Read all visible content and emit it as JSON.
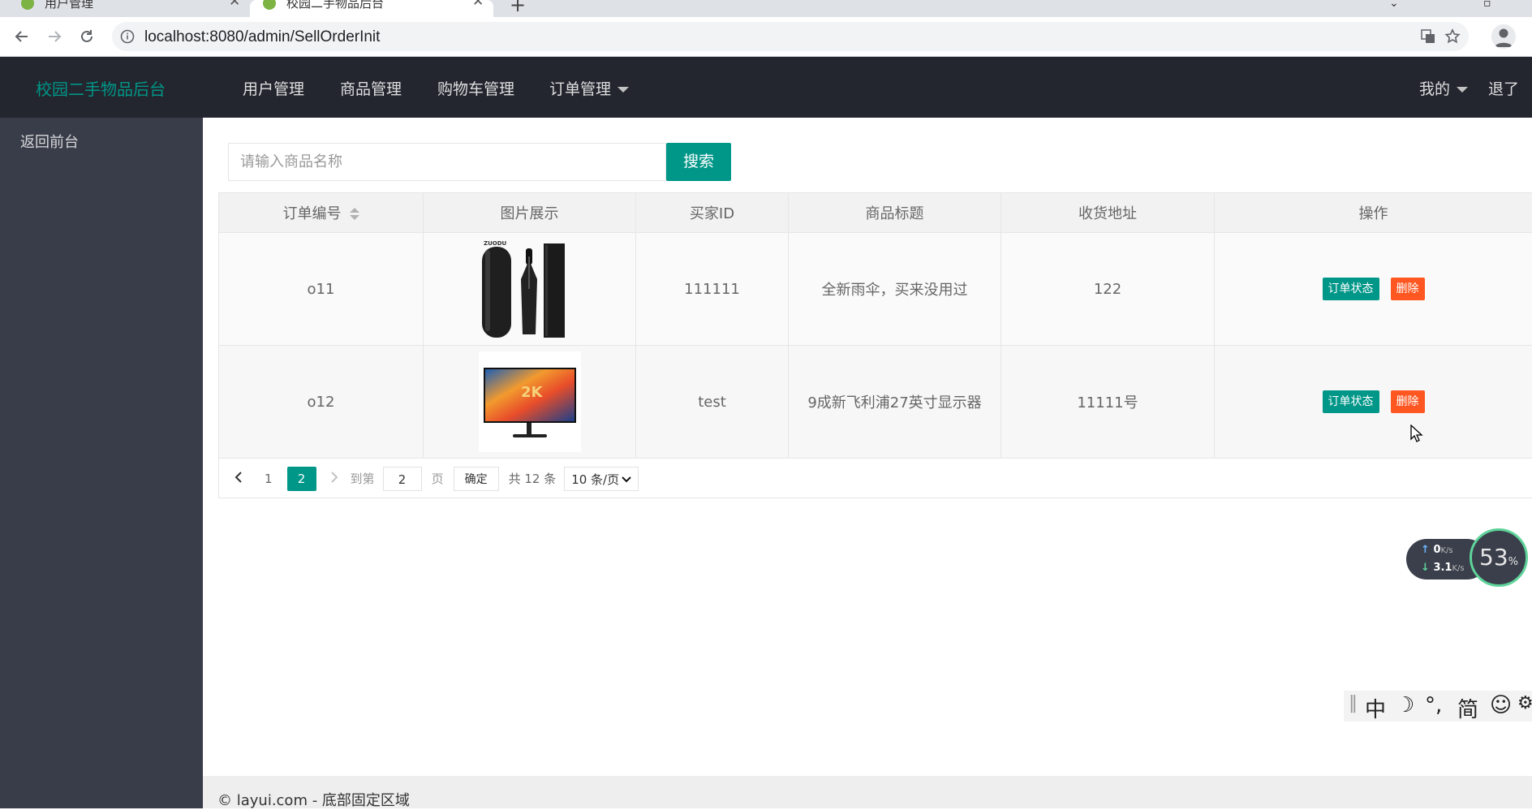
{
  "browser": {
    "tabs": [
      {
        "title": "用户管理",
        "active": false
      },
      {
        "title": "校园二手物品后台",
        "active": true
      }
    ],
    "new_tab_label": "+",
    "url": "localhost:8080/admin/SellOrderInit"
  },
  "header": {
    "logo": "校园二手物品后台",
    "nav": [
      "用户管理",
      "商品管理",
      "购物车管理",
      "订单管理"
    ],
    "user_menu": "我的",
    "logout": "退了"
  },
  "sidebar": {
    "items": [
      "返回前台"
    ]
  },
  "search": {
    "placeholder": "请输入商品名称",
    "button": "搜索"
  },
  "table": {
    "columns": [
      "订单编号",
      "图片展示",
      "买家ID",
      "商品标题",
      "收货地址",
      "操作"
    ],
    "rows": [
      {
        "order_no": "o11",
        "image": "umbrella",
        "buyer_id": "111111",
        "title": "全新雨伞，买来没用过",
        "address": "122",
        "image_caption": "ZUODU"
      },
      {
        "order_no": "o12",
        "image": "monitor",
        "buyer_id": "test",
        "title": "9成新飞利浦27英寸显示器",
        "address": "11111号",
        "image_caption": "2K"
      }
    ],
    "actions": {
      "status": "订单状态",
      "delete": "删除"
    }
  },
  "pagination": {
    "prev_icon": "chevron-left",
    "pages": [
      "1",
      "2"
    ],
    "current": "2",
    "goto_label": "到第",
    "goto_value": "2",
    "page_unit": "页",
    "confirm": "确定",
    "total": "共 12 条",
    "limit": "10 条/页"
  },
  "network_widget": {
    "upload": "0",
    "upload_unit": "K/s",
    "download": "3.1",
    "download_unit": "K/s",
    "percent": "53",
    "percent_unit": "%"
  },
  "ime": [
    "中",
    "简"
  ],
  "footer": "© layui.com - 底部固定区域",
  "colors": {
    "accent": "#009688",
    "danger": "#ff5722",
    "header_bg": "#23262e",
    "sidebar_bg": "#393d49"
  }
}
